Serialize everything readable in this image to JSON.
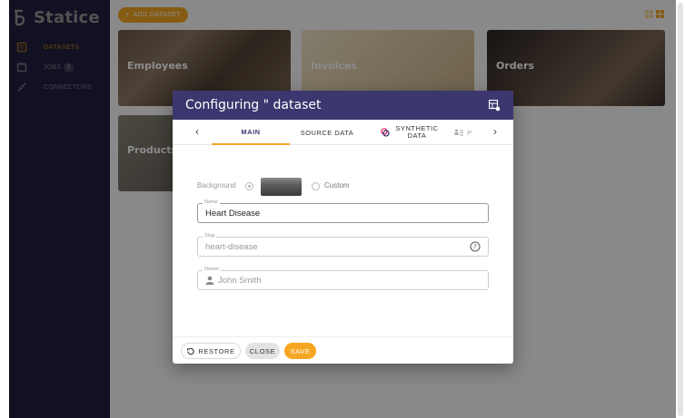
{
  "app": {
    "name": "Statice"
  },
  "sidebar": {
    "items": [
      {
        "label": "DATASETS",
        "icon": "datasets-icon",
        "active": true
      },
      {
        "label": "JOBS",
        "icon": "jobs-icon",
        "badge": "2"
      },
      {
        "label": "CONNECTORS",
        "icon": "connectors-icon"
      }
    ]
  },
  "topbar": {
    "add_label": "ADD DATASET",
    "add_icon": "plus-icon"
  },
  "cards": [
    "Employees",
    "Invoices",
    "Orders",
    "Products"
  ],
  "dialog": {
    "title": "Configuring \" dataset",
    "tabs": [
      "MAIN",
      "SOURCE DATA",
      "SYNTHETIC",
      "DATA",
      "P"
    ],
    "background_label": "Background",
    "custom_label": "Custom",
    "name": {
      "label": "Name",
      "value": "Heart Disease"
    },
    "slug": {
      "label": "Slug",
      "value": "heart-disease"
    },
    "owner": {
      "label": "Owner",
      "value": "John Smith"
    },
    "buttons": {
      "restore": "RESTORE",
      "close": "CLOSE",
      "save": "SAVE"
    }
  },
  "colors": {
    "sidebar": "#3c376e",
    "accent": "#f5a623"
  }
}
